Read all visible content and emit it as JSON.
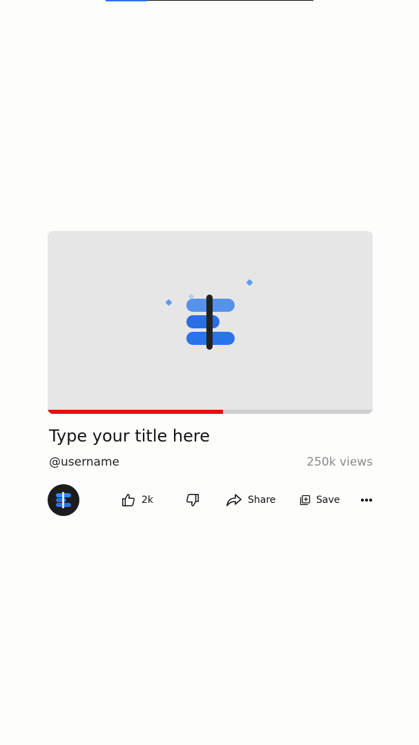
{
  "top_progress": {
    "fraction": 0.2
  },
  "video": {
    "thumbnail_icon": "stacked-bars-logo-icon",
    "progress_fraction": 0.54,
    "progress_color": "#e8100f",
    "accent_color": "#2a73e8"
  },
  "title": "Type your title here",
  "channel": {
    "username": "@username",
    "avatar_icon": "stacked-bars-logo-icon"
  },
  "views": "250k views",
  "actions": {
    "like_icon": "thumbs-up-icon",
    "like_count": "2k",
    "dislike_icon": "thumbs-down-icon",
    "share_icon": "share-arrow-icon",
    "share_label": "Share",
    "save_icon": "save-playlist-icon",
    "save_label": "Save",
    "more_icon": "more-dots-icon"
  }
}
